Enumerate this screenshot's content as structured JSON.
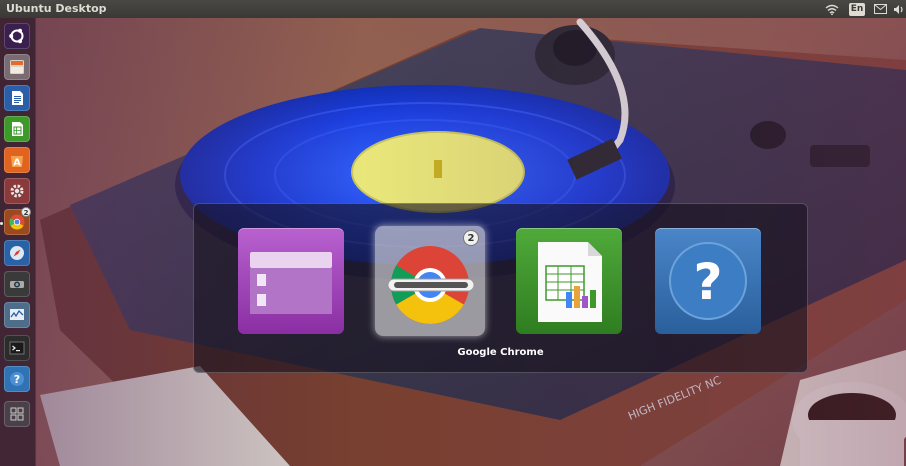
{
  "panel": {
    "title": "Ubuntu Desktop",
    "tray": {
      "wifi_icon": "wifi-icon",
      "language": "En",
      "mail_icon": "mail-icon",
      "sound_icon": "sound-icon"
    }
  },
  "launcher": {
    "items": [
      {
        "name": "dash-home",
        "icon": "ubuntu-logo-icon"
      },
      {
        "name": "files",
        "icon": "file-cabinet-icon"
      },
      {
        "name": "libreoffice-writer",
        "icon": "document-icon"
      },
      {
        "name": "libreoffice-calc",
        "icon": "spreadsheet-icon"
      },
      {
        "name": "ubuntu-software-center",
        "icon": "software-bag-icon"
      },
      {
        "name": "system-settings",
        "icon": "gear-wrench-icon"
      },
      {
        "name": "google-chrome",
        "icon": "chrome-icon",
        "badge": "2"
      },
      {
        "name": "web-browser",
        "icon": "compass-icon"
      },
      {
        "name": "webcam",
        "icon": "camera-icon"
      },
      {
        "name": "system-monitor",
        "icon": "monitor-chart-icon"
      },
      {
        "name": "terminal",
        "icon": "terminal-icon"
      },
      {
        "name": "help",
        "icon": "question-icon"
      },
      {
        "name": "workspaces",
        "icon": "workspaces-icon"
      }
    ]
  },
  "switcher": {
    "selected_label": "Google Chrome",
    "items": [
      {
        "name": "files",
        "icon": "file-cabinet-icon",
        "selected": false
      },
      {
        "name": "google-chrome",
        "icon": "chrome-icon",
        "selected": true,
        "badge": "2"
      },
      {
        "name": "libreoffice-calc",
        "icon": "spreadsheet-icon",
        "selected": false
      },
      {
        "name": "help",
        "icon": "question-icon",
        "selected": false
      }
    ]
  },
  "colors": {
    "panel": "#3a3935",
    "panel_text": "#dfdbd2",
    "files_purple": "#9b3db0",
    "calc_green": "#3d9a2a",
    "help_blue": "#2f73b5"
  }
}
